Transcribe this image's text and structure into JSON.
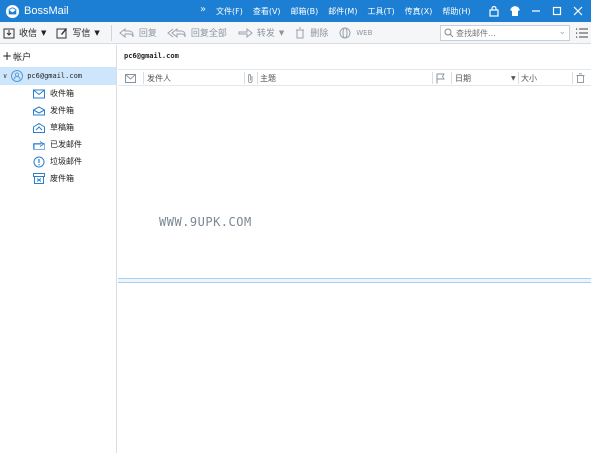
{
  "app": {
    "title": "BossMail"
  },
  "menu": [
    {
      "label": "文件(F)"
    },
    {
      "label": "查看(V)"
    },
    {
      "label": "邮箱(B)"
    },
    {
      "label": "邮件(M)"
    },
    {
      "label": "工具(T)"
    },
    {
      "label": "传真(X)"
    },
    {
      "label": "帮助(H)"
    }
  ],
  "toolbar": {
    "receive": "收信",
    "compose": "写信",
    "reply": "回复",
    "reply_all": "回复全部",
    "forward": "转发",
    "delete": "删除",
    "web": "WEB",
    "search_placeholder": "查找邮件..."
  },
  "sidebar": {
    "add_account": "帐户",
    "account": "pc6@gmail.com",
    "folders": [
      {
        "label": "收件箱",
        "icon": "inbox-icon"
      },
      {
        "label": "发件箱",
        "icon": "outbox-icon"
      },
      {
        "label": "草稿箱",
        "icon": "drafts-icon"
      },
      {
        "label": "已发邮件",
        "icon": "sent-icon"
      },
      {
        "label": "垃圾邮件",
        "icon": "spam-icon"
      },
      {
        "label": "废件箱",
        "icon": "trash-folder-icon"
      }
    ]
  },
  "main": {
    "account_header": "pc6@gmail.com",
    "columns": {
      "sender": "发件人",
      "subject": "主题",
      "date": "日期",
      "size": "大小"
    },
    "watermark": "WWW.9UPK.COM"
  },
  "colors": {
    "titlebar": "#1d7fd3",
    "selected_row": "#cde6fb",
    "accent_icon": "#2a7fcf"
  }
}
